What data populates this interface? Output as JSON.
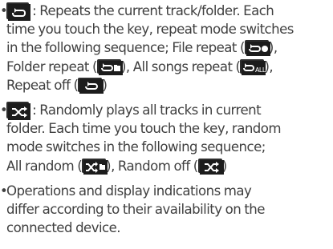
{
  "icons": {
    "repeat_key": "repeat-icon",
    "repeat_file": "repeat-file-icon",
    "repeat_folder": "repeat-folder-icon",
    "repeat_all": "repeat-all-icon",
    "repeat_off": "repeat-off-icon",
    "random_key": "shuffle-icon",
    "random_all": "shuffle-all-icon",
    "random_off": "shuffle-off-icon"
  },
  "items": [
    {
      "bullet": "•",
      "lines": [
        " : Repeats the current track/folder. Each",
        "time you touch the key, repeat mode switches",
        "in the following sequence; File repeat (",
        "),",
        "Folder repeat (",
        "), All songs repeat (",
        "),",
        "Repeat off (",
        ")"
      ]
    },
    {
      "bullet": "•",
      "lines": [
        " : Randomly plays all tracks in current",
        "folder. Each time you touch the key, random",
        "mode switches in the following sequence;",
        "All random (",
        "), Random off (",
        ")"
      ]
    },
    {
      "bullet": "•",
      "lines": [
        "Operations and display indications may",
        "differ according to their availability on the",
        "connected device."
      ]
    }
  ]
}
